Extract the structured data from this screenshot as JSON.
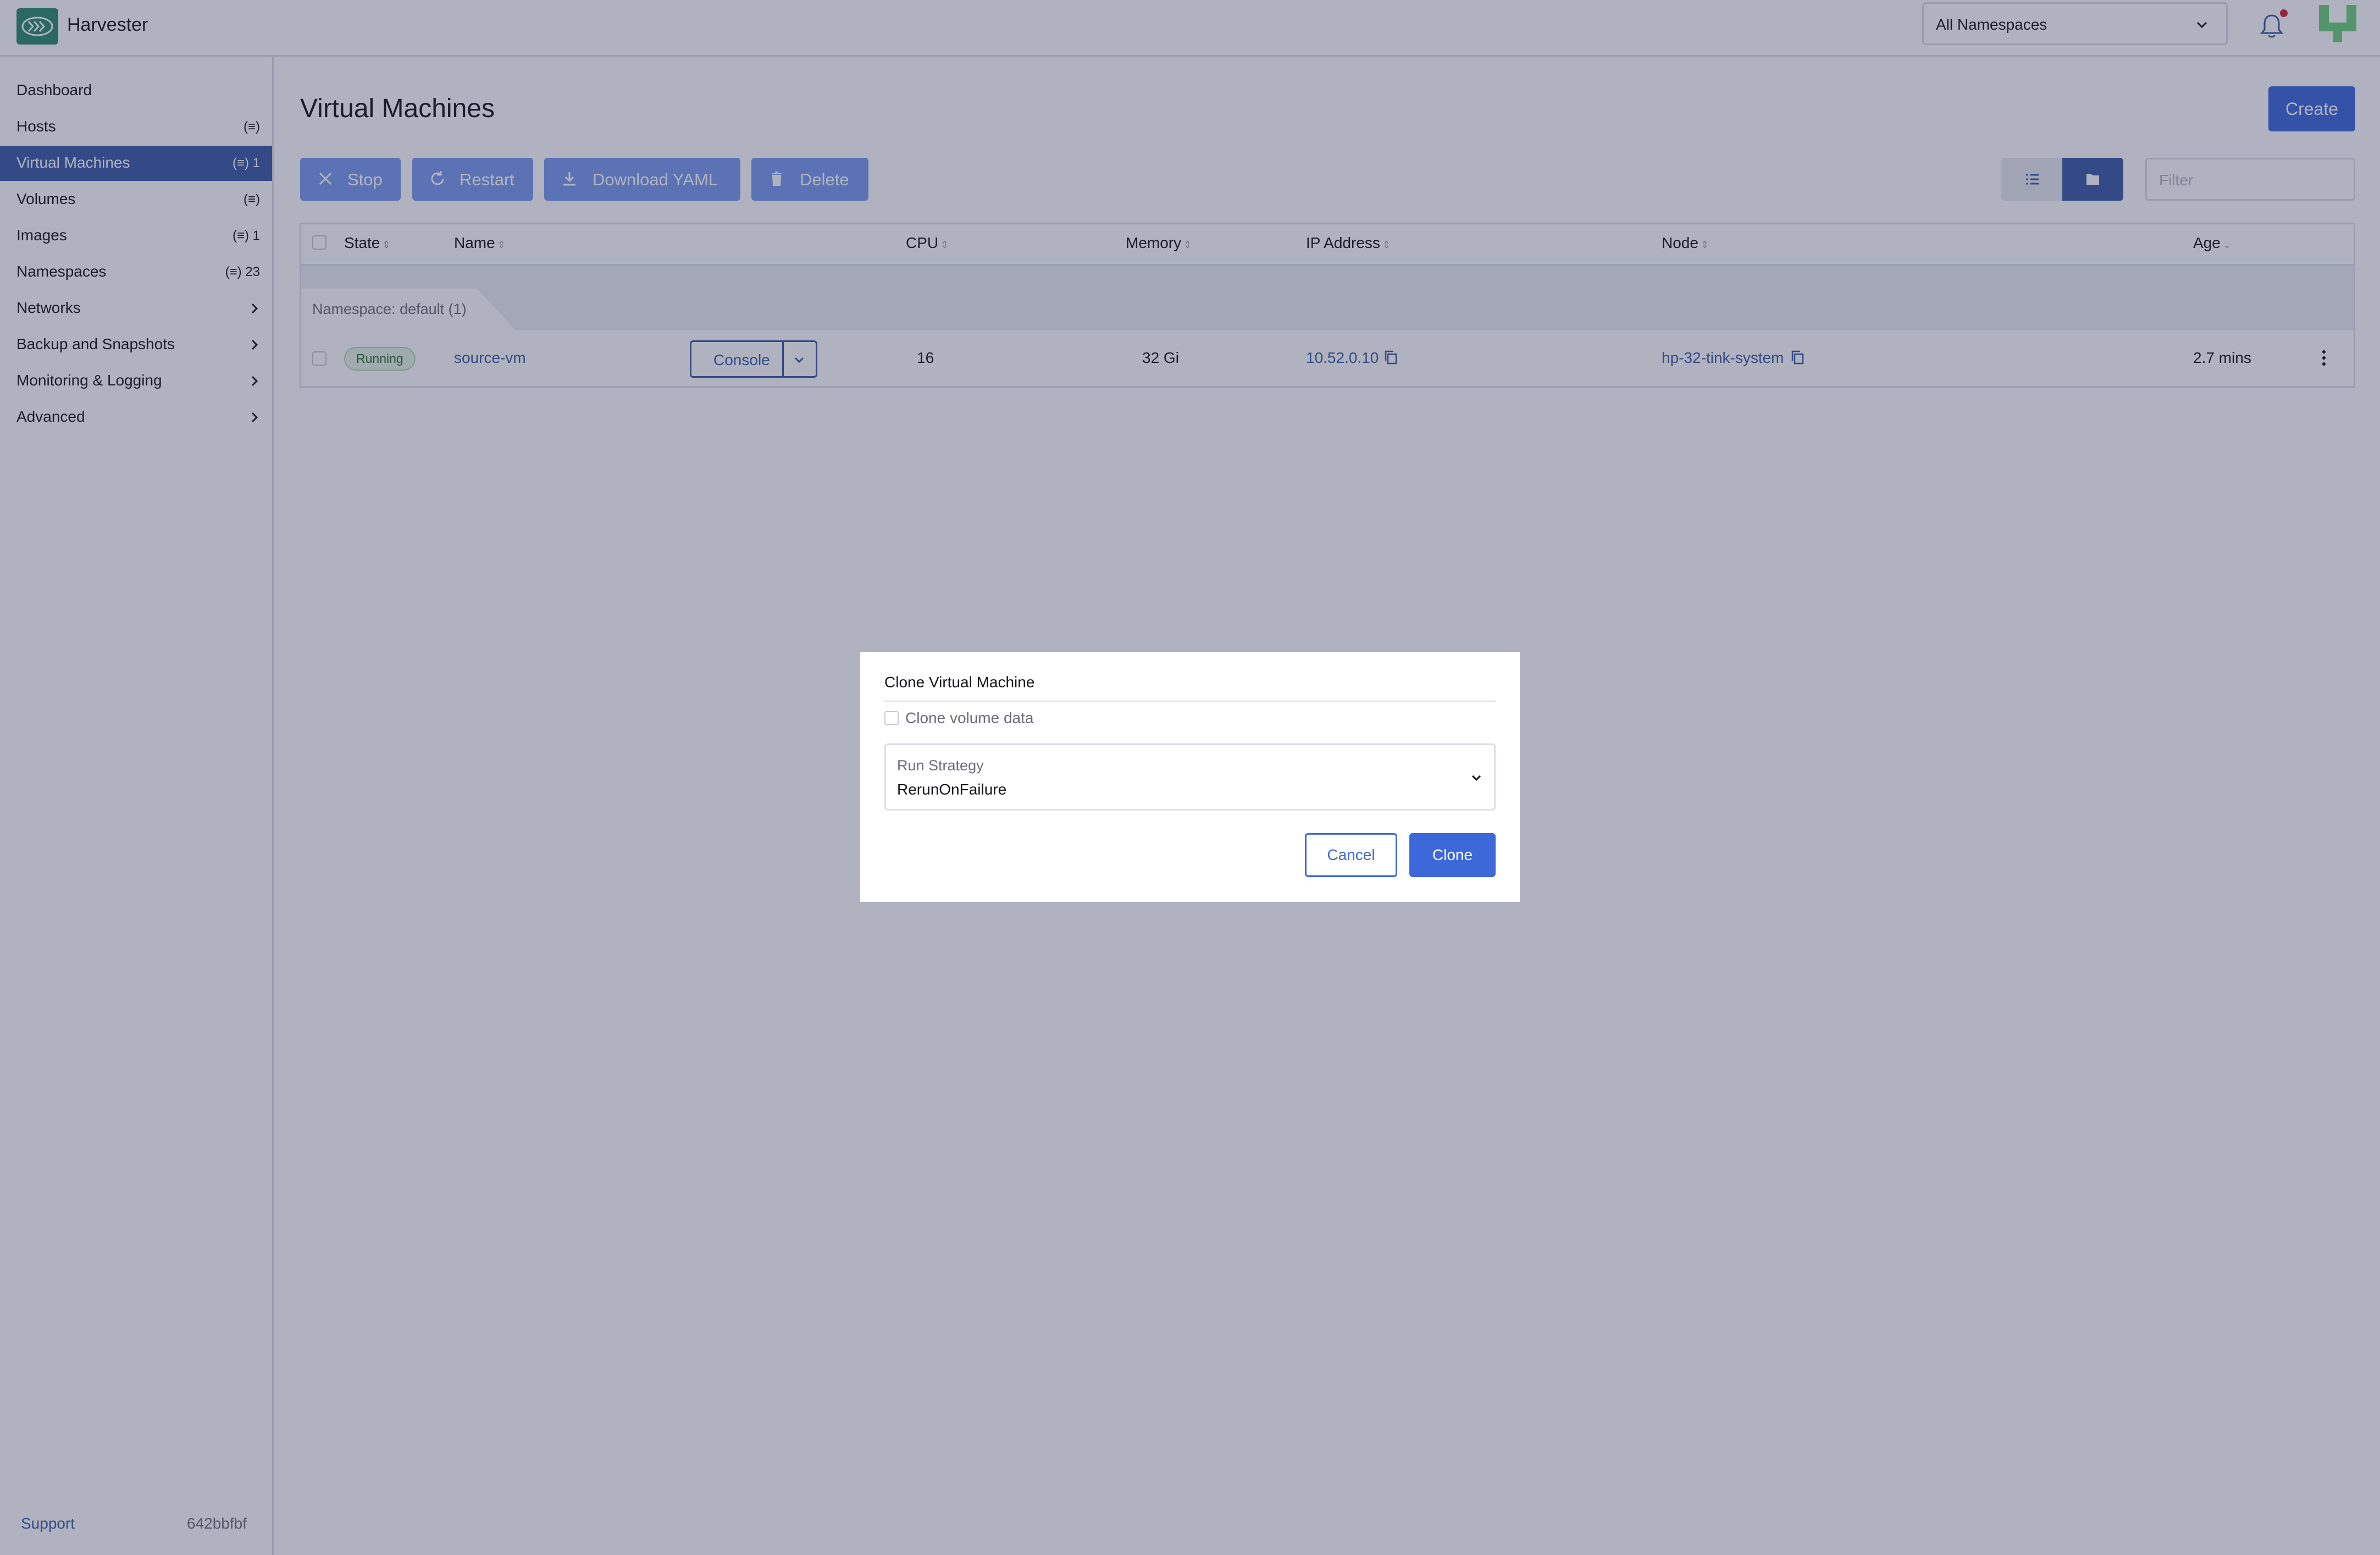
{
  "app": {
    "name": "Harvester",
    "brand_color": "#2e8a6e",
    "accent_color": "#3d68d9"
  },
  "header": {
    "namespace_select": "All Namespaces"
  },
  "sidebar": {
    "items": [
      {
        "label": "Dashboard",
        "meta": ""
      },
      {
        "label": "Hosts",
        "meta": ""
      },
      {
        "label": "Virtual Machines",
        "meta": "1"
      },
      {
        "label": "Volumes",
        "meta": ""
      },
      {
        "label": "Images",
        "meta": "1"
      },
      {
        "label": "Namespaces",
        "meta": "23"
      },
      {
        "label": "Networks",
        "meta": ""
      },
      {
        "label": "Backup and Snapshots",
        "meta": ""
      },
      {
        "label": "Monitoring & Logging",
        "meta": ""
      },
      {
        "label": "Advanced",
        "meta": ""
      }
    ],
    "support": "Support",
    "version": "642bbfbf"
  },
  "main": {
    "title": "Virtual Machines",
    "create": "Create",
    "bulk": {
      "stop": "Stop",
      "restart": "Restart",
      "download": "Download YAML",
      "delete": "Delete"
    },
    "filter_placeholder": "Filter",
    "columns": {
      "state": "State",
      "name": "Name",
      "cpu": "CPU",
      "memory": "Memory",
      "ip": "IP Address",
      "node": "Node",
      "age": "Age"
    },
    "group": "Namespace: default  (1)",
    "row": {
      "state": "Running",
      "name": "source-vm",
      "console": "Console",
      "cpu": "16",
      "memory": "32 Gi",
      "ip": "10.52.0.10",
      "node": "hp-32-tink-system",
      "age": "2.7 mins"
    }
  },
  "modal": {
    "title": "Clone Virtual Machine",
    "clone_volume_label": "Clone volume data",
    "run_strategy_label": "Run Strategy",
    "run_strategy_value": "RerunOnFailure",
    "cancel": "Cancel",
    "clone": "Clone"
  }
}
